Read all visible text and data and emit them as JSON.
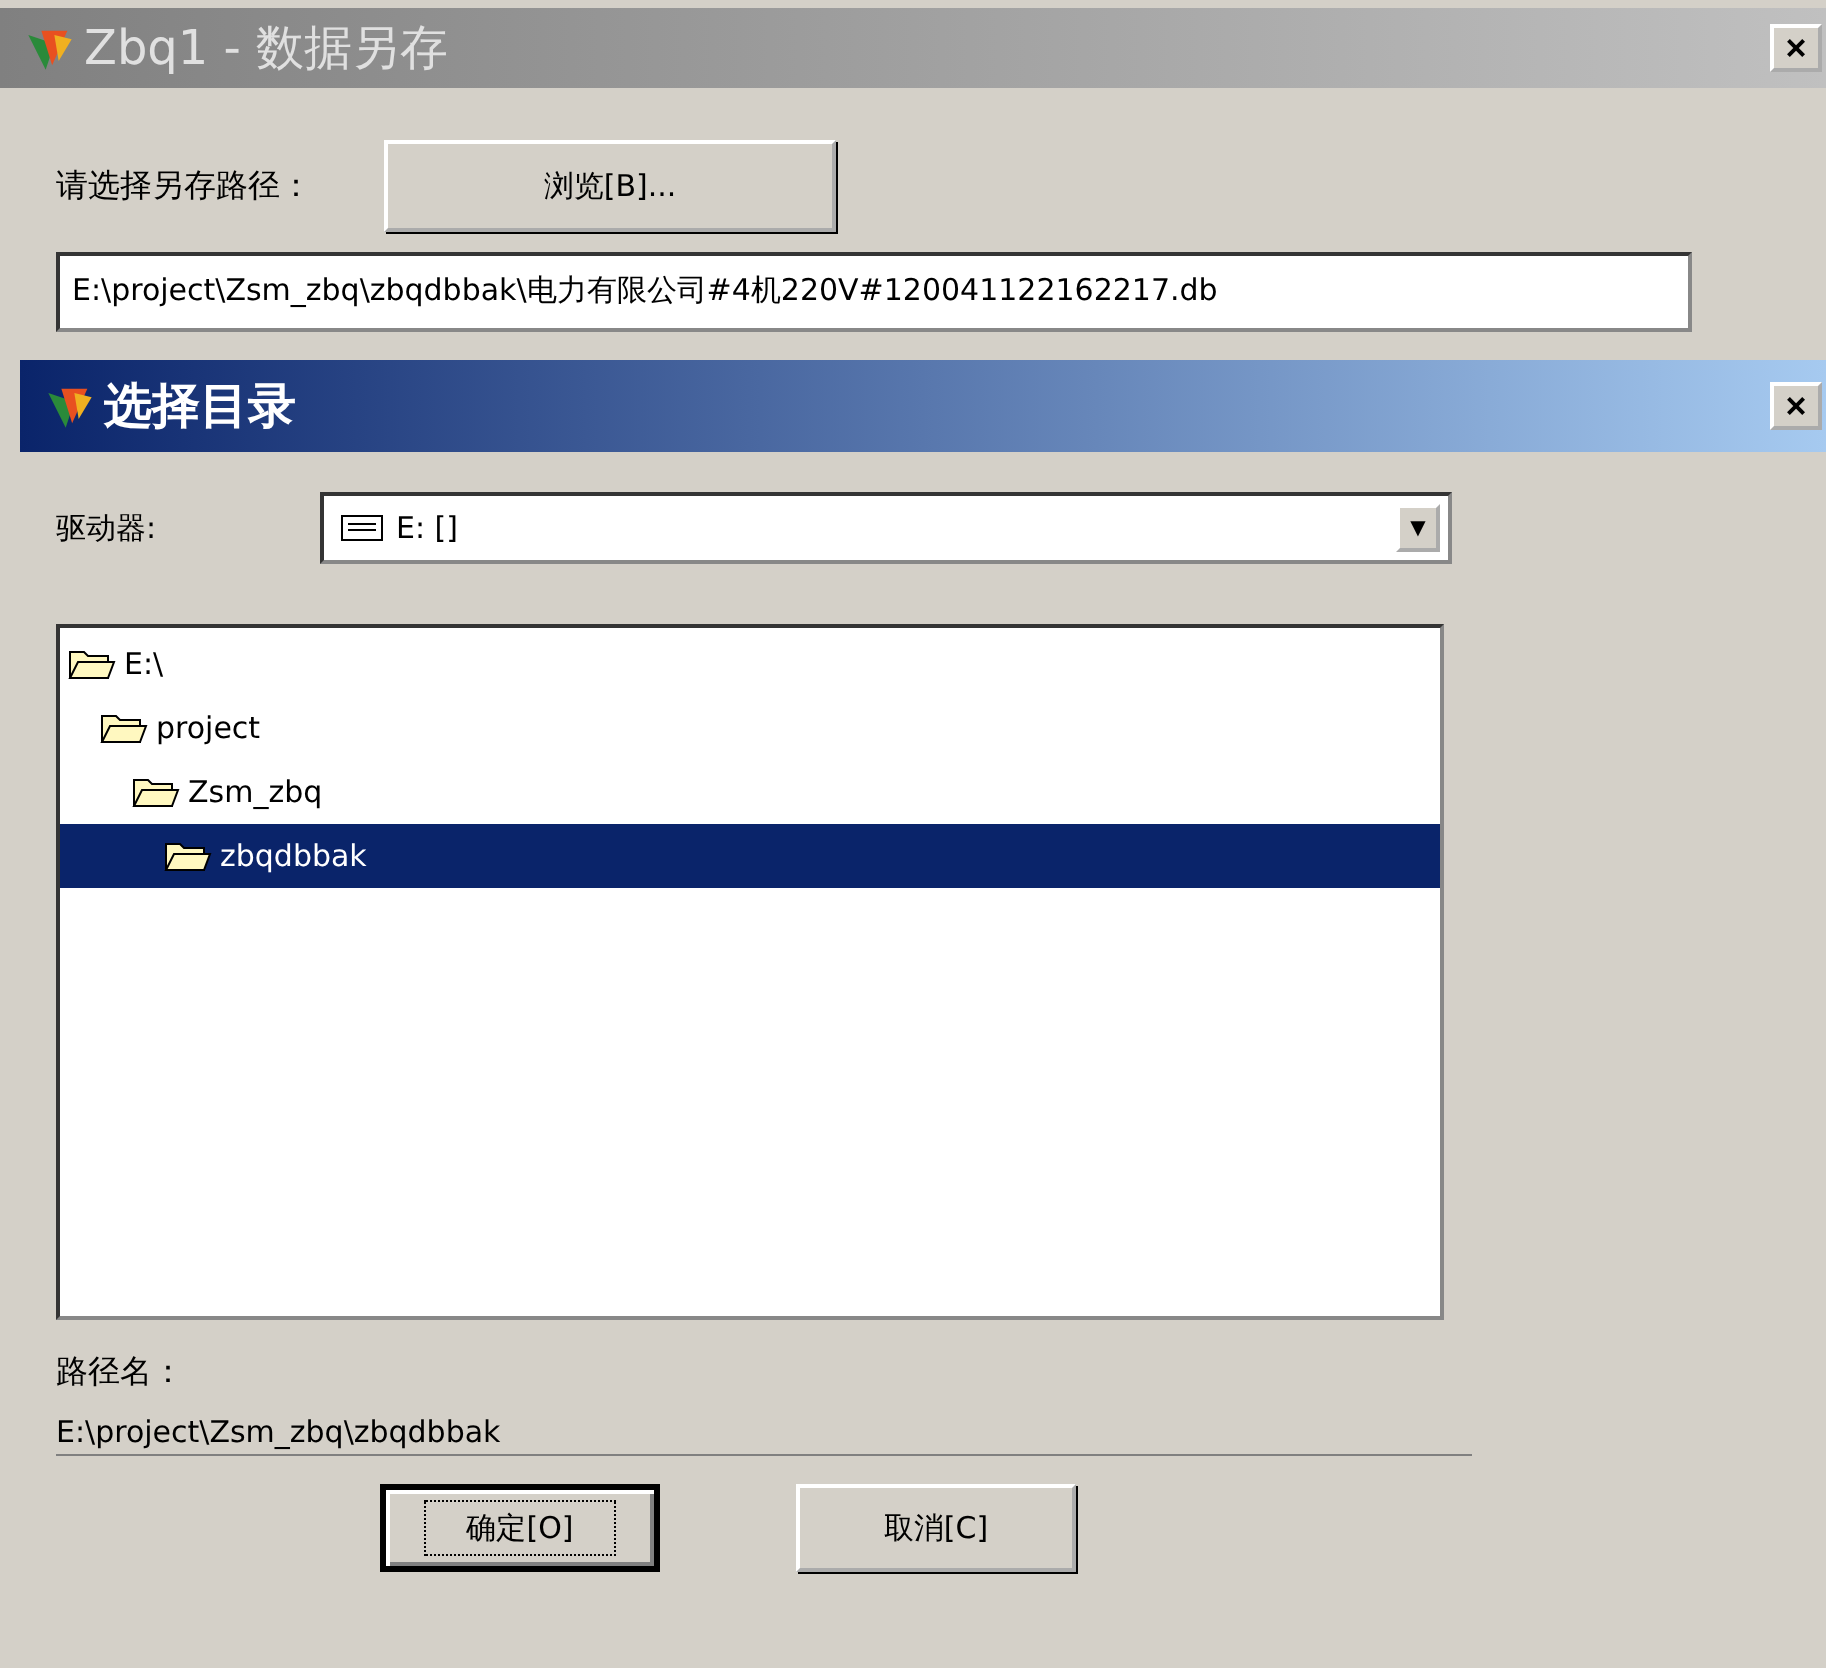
{
  "window": {
    "title": "Zbq1 - 数据另存",
    "close": "×"
  },
  "save_path": {
    "label": "请选择另存路径：",
    "browse_button": "浏览[B]...",
    "value": "E:\\project\\Zsm_zbq\\zbqdbbak\\电力有限公司#4机220V#120041122162217.db"
  },
  "dialog": {
    "title": "选择目录",
    "close": "×",
    "drive": {
      "label": "驱动器:",
      "value": "E: []",
      "arrow": "▼"
    },
    "tree": [
      {
        "name": "E:\\",
        "selected": false,
        "children": [
          {
            "name": "project",
            "selected": false,
            "children": [
              {
                "name": "Zsm_zbq",
                "selected": false,
                "children": [
                  {
                    "name": "zbqdbbak",
                    "selected": true
                  }
                ]
              }
            ]
          }
        ]
      }
    ],
    "path_label": "路径名：",
    "path_value": "E:\\project\\Zsm_zbq\\zbqdbbak",
    "buttons": [
      {
        "label": "确定[O]",
        "focused": true
      },
      {
        "label": "取消[C]",
        "focused": false
      }
    ]
  }
}
